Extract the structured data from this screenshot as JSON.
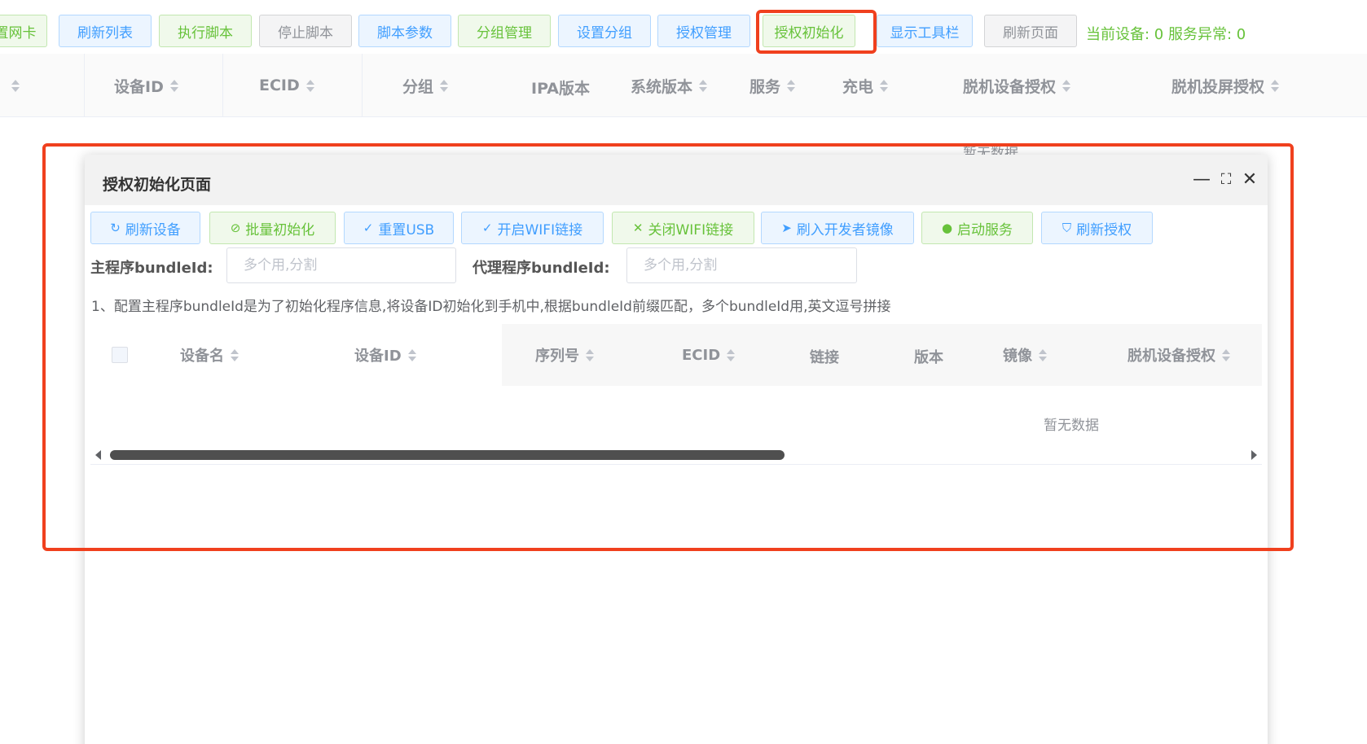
{
  "toolbar": {
    "buttons": [
      {
        "label": "置网卡"
      },
      {
        "label": "刷新列表"
      },
      {
        "label": "执行脚本"
      },
      {
        "label": "停止脚本"
      },
      {
        "label": "脚本参数"
      },
      {
        "label": "分组管理"
      },
      {
        "label": "设置分组"
      },
      {
        "label": "授权管理"
      },
      {
        "label": "授权初始化"
      },
      {
        "label": "显示工具栏"
      },
      {
        "label": "刷新页面"
      }
    ],
    "status": "当前设备: 0 服务异常: 0"
  },
  "main_table": {
    "columns": [
      "设备ID",
      "ECID",
      "分组",
      "IPA版本",
      "系统版本",
      "服务",
      "充电",
      "脱机设备授权",
      "脱机投屏授权"
    ],
    "empty_text": "暂无数据"
  },
  "dialog": {
    "title": "授权初始化页面",
    "controls": {
      "minimize": "—",
      "maximize": "⛶",
      "close": "✕"
    },
    "actions": [
      {
        "label": "刷新设备",
        "icon": "↻"
      },
      {
        "label": "批量初始化",
        "icon": "⊘"
      },
      {
        "label": "重置USB",
        "icon": "✓"
      },
      {
        "label": "开启WIFI链接",
        "icon": "✓"
      },
      {
        "label": "关闭WIFI链接",
        "icon": "✕"
      },
      {
        "label": "刷入开发者镜像",
        "icon": "➤"
      },
      {
        "label": "启动服务",
        "icon": "●"
      },
      {
        "label": "刷新授权",
        "icon": "⛉"
      }
    ],
    "main_bundle": {
      "label": "主程序bundleId:",
      "placeholder": "多个用,分割",
      "value": ""
    },
    "proxy_bundle": {
      "label": "代理程序bundleId:",
      "placeholder": "多个用,分割",
      "value": ""
    },
    "note": "1、配置主程序bundleId是为了初始化程序信息,将设备ID初始化到手机中,根据bundleId前缀匹配，多个bundleId用,英文逗号拼接",
    "table": {
      "columns": [
        "设备名",
        "设备ID",
        "序列号",
        "ECID",
        "链接",
        "版本",
        "镜像",
        "脱机设备授权"
      ],
      "empty_text": "暂无数据"
    }
  },
  "colors": {
    "primary": "#409eff",
    "success": "#67c23a",
    "info": "#909399",
    "highlight": "#f0401e"
  }
}
